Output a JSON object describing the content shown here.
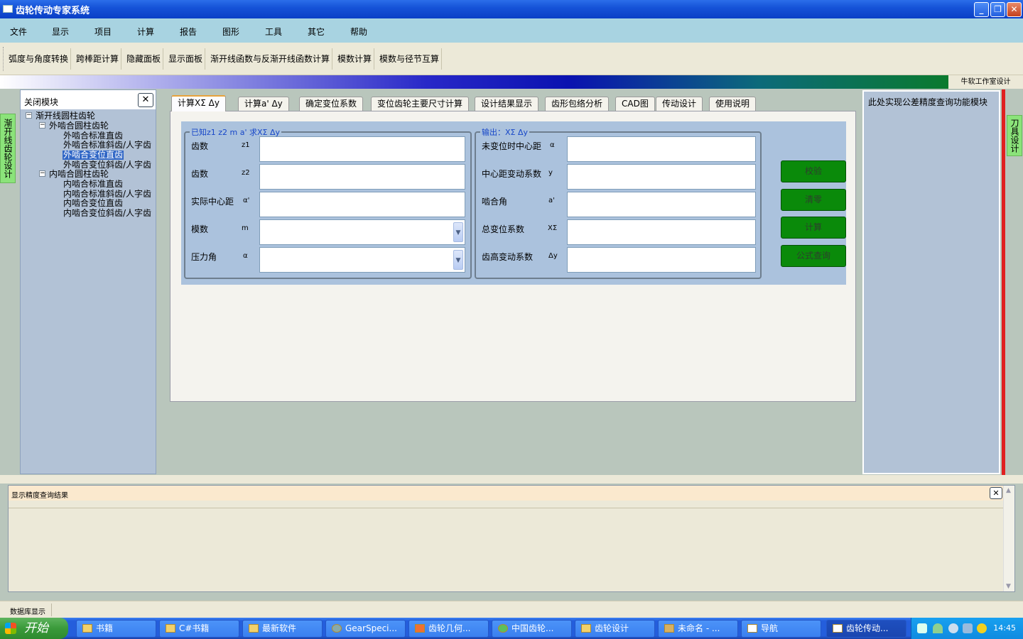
{
  "window": {
    "title": "齿轮传动专家系统",
    "minimize": "_",
    "restore": "❐",
    "close": "✕"
  },
  "menu": [
    "文件",
    "显示",
    "项目",
    "计算",
    "报告",
    "图形",
    "工具",
    "其它",
    "帮助"
  ],
  "toolbar": [
    "弧度与角度转换",
    "跨棒距计算",
    "隐藏面板",
    "显示面板",
    "渐开线函数与反渐开线函数计算",
    "模数计算",
    "模数与径节互算"
  ],
  "studio_label": "牛软工作室设计",
  "left_vertical_tab": "渐开线齿轮设计",
  "right_vertical_tab": "刀具设计",
  "left_panel": {
    "header": "关闭模块",
    "close": "✕",
    "tree": {
      "root": "渐开线圆柱齿轮",
      "groups": [
        {
          "label": "外啮合圆柱齿轮",
          "items": [
            "外啮合标准直齿",
            "外啮合标准斜齿/人字齿",
            "外啮合变位直齿",
            "外啮合变位斜齿/人字齿"
          ]
        },
        {
          "label": "内啮合圆柱齿轮",
          "items": [
            "内啮合标准直齿",
            "内啮合标准斜齿/人字齿",
            "内啮合变位直齿",
            "内啮合变位斜齿/人字齿"
          ]
        }
      ],
      "selected": "外啮合变位直齿"
    }
  },
  "tabs": [
    "计算XΣ Δy",
    "计算a' Δy",
    "确定变位系数",
    "变位齿轮主要尺寸计算",
    "设计结果显示",
    "齿形包络分析",
    "CAD图",
    "传动设计",
    "使用说明"
  ],
  "active_tab": "计算XΣ Δy",
  "input_group": {
    "legend": "已知z1 z2 m a' 求XΣ Δy",
    "fields": [
      {
        "label": "齿数",
        "symbol": "z1",
        "value": ""
      },
      {
        "label": "齿数",
        "symbol": "z2",
        "value": ""
      },
      {
        "label": "实际中心距",
        "symbol": "α'",
        "value": ""
      },
      {
        "label": "模数",
        "symbol": "m",
        "value": ""
      },
      {
        "label": "压力角",
        "symbol": "α",
        "value": ""
      }
    ]
  },
  "output_group": {
    "legend": "输出：XΣ Δy",
    "fields": [
      {
        "label": "未变位时中心距",
        "symbol": "α",
        "value": ""
      },
      {
        "label": "中心距变动系数",
        "symbol": "y",
        "value": ""
      },
      {
        "label": "啮合角",
        "symbol": "a'",
        "value": ""
      },
      {
        "label": "总变位系数",
        "symbol": "XΣ",
        "value": ""
      },
      {
        "label": "齿高变动系数",
        "symbol": "Δy",
        "value": ""
      }
    ]
  },
  "buttons": [
    "校验",
    "清零",
    "计算",
    "公式查询"
  ],
  "right_panel": {
    "text": "此处实现公差精度查询功能模块"
  },
  "result_panel": {
    "header": "显示精度查询结果",
    "close": "✕"
  },
  "status": {
    "text": "数据库显示"
  },
  "taskbar": {
    "start": "开始",
    "tasks": [
      "书籍",
      "C#书籍",
      "最新软件",
      "GearSpeci...",
      "齿轮几何...",
      "中国齿轮...",
      "齿轮设计",
      "未命名 - ...",
      "导航",
      "齿轮传动..."
    ],
    "active_task": "齿轮传动...",
    "clock": "14:45"
  },
  "colors": {
    "title_bar": "#1653D8",
    "menu_bg": "#A8D3E1",
    "panel_bg": "#B2C2D6",
    "green_button": "#0A8A0A",
    "vertical_tab": "#8BE37A",
    "legend_text": "#1646C8"
  }
}
